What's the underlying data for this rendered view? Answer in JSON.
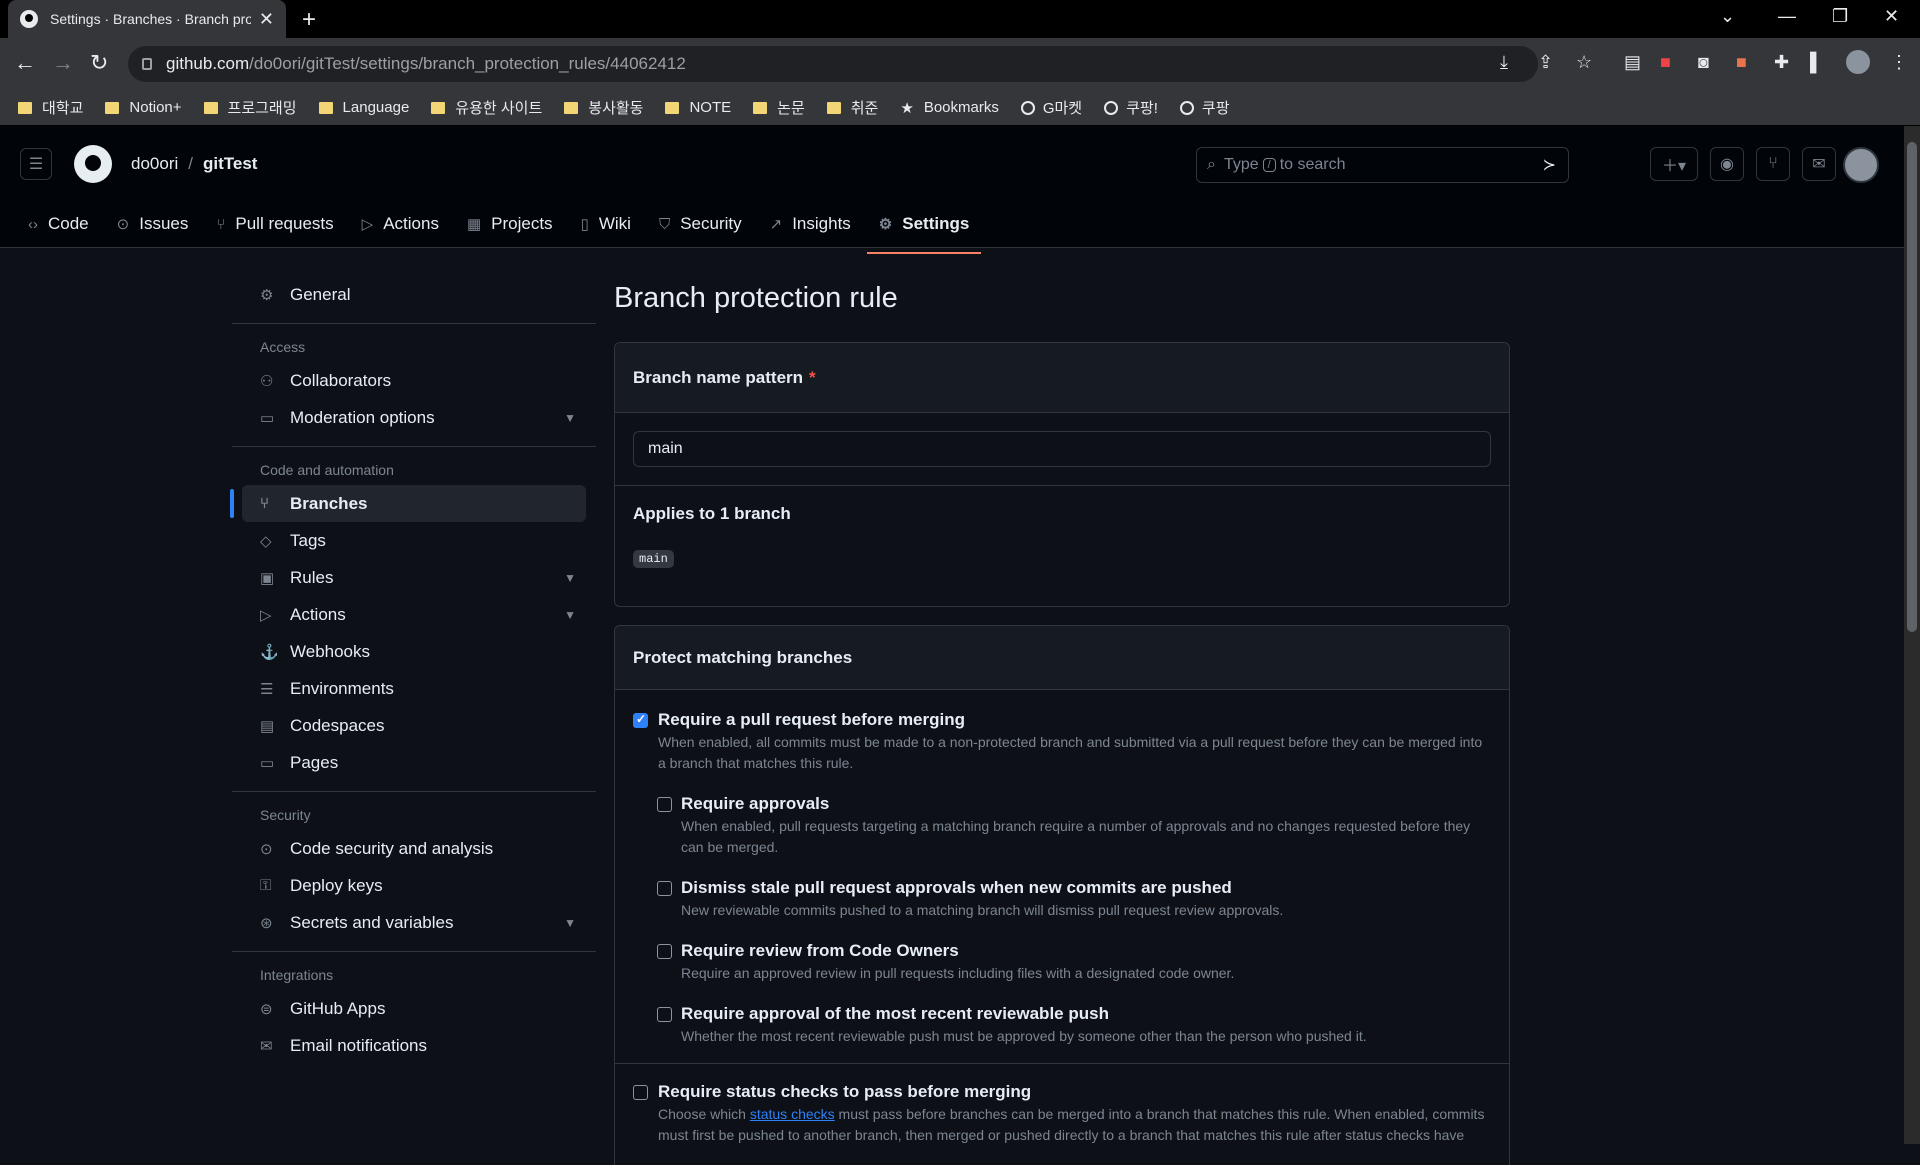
{
  "browser": {
    "tab_title": "Settings · Branches · Branch pro",
    "url_host": "github.com",
    "url_path": "/do0ori/gitTest/settings/branch_protection_rules/44062412",
    "bookmarks": [
      {
        "label": "대학교",
        "icon": "folder-icon"
      },
      {
        "label": "Notion+",
        "icon": "folder-icon"
      },
      {
        "label": "프로그래밍",
        "icon": "folder-icon"
      },
      {
        "label": "Language",
        "icon": "folder-icon"
      },
      {
        "label": "유용한 사이트",
        "icon": "folder-icon"
      },
      {
        "label": "봉사활동",
        "icon": "folder-icon"
      },
      {
        "label": "NOTE",
        "icon": "folder-icon"
      },
      {
        "label": "논문",
        "icon": "folder-icon"
      },
      {
        "label": "취준",
        "icon": "folder-icon"
      },
      {
        "label": "Bookmarks",
        "icon": "star-icon"
      },
      {
        "label": "G마켓",
        "icon": "globe-icon"
      },
      {
        "label": "쿠팡!",
        "icon": "globe-icon"
      },
      {
        "label": "쿠팡",
        "icon": "globe-icon"
      }
    ]
  },
  "header": {
    "owner": "do0ori",
    "separator": "/",
    "repo": "gitTest",
    "search_prefix": "Type",
    "search_key": "/",
    "search_suffix": "to search"
  },
  "repo_nav": [
    {
      "label": "Code",
      "icon": "code-icon"
    },
    {
      "label": "Issues",
      "icon": "issue-icon"
    },
    {
      "label": "Pull requests",
      "icon": "pull-request-icon"
    },
    {
      "label": "Actions",
      "icon": "play-icon"
    },
    {
      "label": "Projects",
      "icon": "table-icon"
    },
    {
      "label": "Wiki",
      "icon": "book-icon"
    },
    {
      "label": "Security",
      "icon": "shield-icon"
    },
    {
      "label": "Insights",
      "icon": "graph-icon"
    },
    {
      "label": "Settings",
      "icon": "gear-icon"
    }
  ],
  "sidebar": {
    "general": "General",
    "access_heading": "Access",
    "collaborators": "Collaborators",
    "moderation": "Moderation options",
    "code_heading": "Code and automation",
    "branches": "Branches",
    "tags": "Tags",
    "rules": "Rules",
    "actions": "Actions",
    "webhooks": "Webhooks",
    "environments": "Environments",
    "codespaces": "Codespaces",
    "pages": "Pages",
    "security_heading": "Security",
    "code_security": "Code security and analysis",
    "deploy_keys": "Deploy keys",
    "secrets": "Secrets and variables",
    "integrations_heading": "Integrations",
    "github_apps": "GitHub Apps",
    "email": "Email notifications"
  },
  "main": {
    "title": "Branch protection rule",
    "pattern_label": "Branch name pattern",
    "required_mark": "*",
    "pattern_value": "main",
    "applies_label": "Applies to 1 branch",
    "applies_branch": "main",
    "protect_heading": "Protect matching branches",
    "options": {
      "require_pr": {
        "label": "Require a pull request before merging",
        "checked": true,
        "desc": "When enabled, all commits must be made to a non-protected branch and submitted via a pull request before they can be merged into a branch that matches this rule."
      },
      "require_approvals": {
        "label": "Require approvals",
        "checked": false,
        "desc": "When enabled, pull requests targeting a matching branch require a number of approvals and no changes requested before they can be merged."
      },
      "dismiss_stale": {
        "label": "Dismiss stale pull request approvals when new commits are pushed",
        "checked": false,
        "desc": "New reviewable commits pushed to a matching branch will dismiss pull request review approvals."
      },
      "code_owners": {
        "label": "Require review from Code Owners",
        "checked": false,
        "desc": "Require an approved review in pull requests including files with a designated code owner."
      },
      "recent_push": {
        "label": "Require approval of the most recent reviewable push",
        "checked": false,
        "desc": "Whether the most recent reviewable push must be approved by someone other than the person who pushed it."
      },
      "status_checks": {
        "label": "Require status checks to pass before merging",
        "checked": false,
        "desc_prefix": "Choose which",
        "desc_link": "status checks",
        "desc_suffix": "must pass before branches can be merged into a branch that matches this rule. When enabled, commits must first be pushed to another branch, then merged or pushed directly to a branch that matches this rule after status checks have"
      }
    }
  }
}
